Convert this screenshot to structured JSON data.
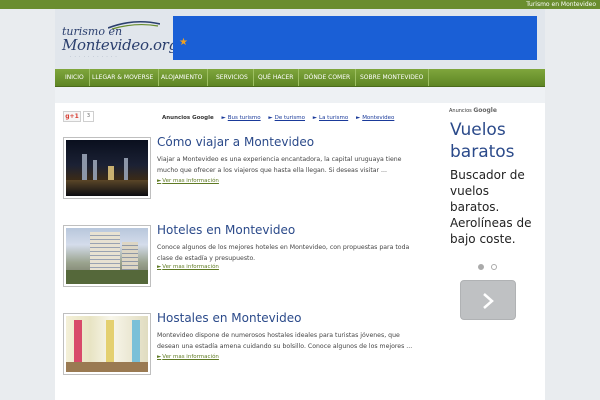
{
  "topbar": {
    "site_link": "Turismo en Montevideo"
  },
  "logo": {
    "line1": "turismo en",
    "line2": "Montevideo.org"
  },
  "nav": {
    "items": [
      "INICIO",
      "LLEGAR & MOVERSE",
      "ALOJAMIENTO",
      "SERVICIOS",
      "QUÉ HACER",
      "DÓNDE COMER",
      "SOBRE MONTEVIDEO"
    ]
  },
  "social": {
    "gplus_label": "g+1",
    "gplus_count": "3"
  },
  "ad_links": {
    "label": "Anuncios Google",
    "links": [
      "Bus turismo",
      "De turismo",
      "La turismo",
      "Montevideo"
    ]
  },
  "articles": [
    {
      "title": "Cómo viajar a Montevideo",
      "body": "Viajar a Montevideo es una experiencia encantadora, la capital uruguaya tiene mucho que ofrecer a los viajeros que hasta ella llegan. Si deseas visitar ...",
      "more": "Ver mas información"
    },
    {
      "title": "Hoteles en Montevideo",
      "body": "Conoce algunos de los mejores hoteles en Montevideo, con propuestas para toda clase de estadía y presupuesto.",
      "more": "Ver mas información"
    },
    {
      "title": "Hostales en Montevideo",
      "body": "Montevideo dispone de numerosos hostales ideales para turistas jóvenes, que desean una estadía amena cuidando su bolsillo. Conoce algunos de los mejores ...",
      "more": "Ver mas información"
    }
  ],
  "sidebar": {
    "ads_label": "Anuncios",
    "ads_brand": "Google",
    "ad_title": "Vuelos baratos",
    "ad_desc": "Buscador de vuelos baratos. Aerolíneas de bajo coste."
  }
}
